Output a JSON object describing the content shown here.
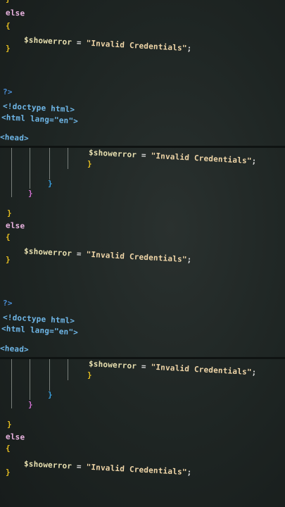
{
  "code": {
    "else_kw": "else",
    "open_brace": "{",
    "close_brace": "}",
    "var": "$showerror",
    "assign": "=",
    "string": "\"Invalid Credentials\"",
    "semicolon": ";",
    "php_close": "?>",
    "doctype": "<!doctype html>",
    "html_tag": "<html lang=\"en\">",
    "head_tag": "<head>"
  },
  "colors": {
    "background": "#1e2523",
    "keyword": "#e9b3e0",
    "brace": "#e8c020",
    "string": "#f0d6a8",
    "tag": "#6fb7e8"
  }
}
